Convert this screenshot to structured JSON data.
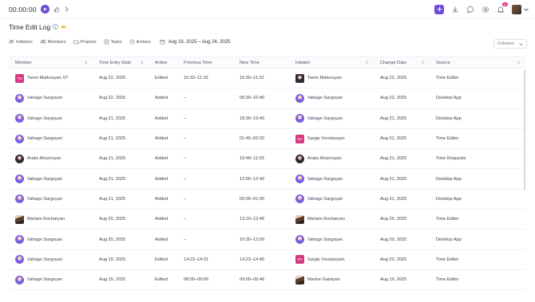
{
  "topbar": {
    "timer": "00:00:00",
    "notifications_count": "16"
  },
  "page": {
    "title": "Time Edit Log"
  },
  "filters": {
    "initiators": "Initiators",
    "members": "Members",
    "projects": "Projects",
    "tasks": "Tasks",
    "actions": "Actions",
    "date_range": "Aug 16, 2025 – Aug 24, 2025",
    "columns": "Columns"
  },
  "table": {
    "headers": {
      "member": "Member",
      "time_entry_date": "Time Entry Date",
      "action": "Action",
      "previous_time": "Previous Time",
      "new_time": "New Time",
      "initiator": "Initiator",
      "change_date": "Change Date",
      "source": "Source"
    },
    "rows": [
      {
        "member": "Taron Markosyan ST",
        "member_avatar": "TM",
        "date": "Aug 22, 2025",
        "action": "Edited",
        "prev": "10:32–11:32",
        "new": "10:30–11:32",
        "initiator": "Taron Markosyan",
        "changed": "Aug 22, 2025",
        "source": "Time Editor"
      },
      {
        "member": "Vahagn Sargsyan",
        "date": "Aug 22, 2025",
        "action": "Added",
        "prev": "–",
        "new": "09:30–10:40",
        "initiator": "Vahagn Sargsyan",
        "changed": "Aug 22, 2025",
        "source": "Desktop App"
      },
      {
        "member": "Vahagn Sargsyan",
        "date": "Aug 21, 2025",
        "action": "Added",
        "prev": "–",
        "new": "18:30–19:40",
        "initiator": "Vahagn Sargsyan",
        "changed": "Aug 21, 2025",
        "source": "Desktop App"
      },
      {
        "member": "Vahagn Sargsyan",
        "date": "Aug 21, 2025",
        "action": "Added",
        "prev": "–",
        "new": "01:45–02:20",
        "initiator": "Sargis Vorskanyan",
        "initiator_avatar": "SV",
        "changed": "Aug 21, 2025",
        "source": "Time Editor"
      },
      {
        "member": "Araks Aharonyan",
        "date": "Aug 21, 2025",
        "action": "Added",
        "prev": "–",
        "new": "10:48–11:03",
        "initiator": "Araks Aharonyan",
        "changed": "Aug 21, 2025",
        "source": "Time Requests"
      },
      {
        "member": "Vahagn Sargsyan",
        "date": "Aug 21, 2025",
        "action": "Added",
        "prev": "–",
        "new": "12:00–12:40",
        "initiator": "Vahagn Sargsyan",
        "changed": "Aug 21, 2025",
        "source": "Desktop App"
      },
      {
        "member": "Vahagn Sargsyan",
        "date": "Aug 21, 2025",
        "action": "Added",
        "prev": "–",
        "new": "00:00–01:00",
        "initiator": "Vahagn Sargsyan",
        "changed": "Aug 21, 2025",
        "source": "Desktop App"
      },
      {
        "member": "Mariam Kocharyan",
        "date": "Aug 20, 2025",
        "action": "Added",
        "prev": "–",
        "new": "13:10–13:46",
        "initiator": "Mariam Kocharyan",
        "changed": "Aug 20, 2025",
        "source": "Time Editor"
      },
      {
        "member": "Vahagn Sargsyan",
        "date": "Aug 20, 2025",
        "action": "Added",
        "prev": "–",
        "new": "10:30–12:00",
        "initiator": "Vahagn Sargsyan",
        "changed": "Aug 20, 2025",
        "source": "Desktop App"
      },
      {
        "member": "Vahagn Sargsyan",
        "date": "Aug 19, 2025",
        "action": "Edited",
        "prev": "14:23–14:31",
        "new": "14:23–14:40",
        "initiator": "Sargis Vorskanyan",
        "initiator_avatar": "SV",
        "changed": "Aug 20, 2025",
        "source": "Time Editor"
      },
      {
        "member": "Vahagn Sargsyan",
        "date": "Aug 19, 2025",
        "action": "Edited",
        "prev": "08:00–09:00",
        "new": "09:00–09:46",
        "initiator": "Marine Galstyan",
        "changed": "Aug 19, 2025",
        "source": "Time Editor"
      }
    ]
  },
  "colors": {
    "accent": "#6f4dd9",
    "initials_avatar": "#d8387f",
    "badge": "#e0267a"
  }
}
